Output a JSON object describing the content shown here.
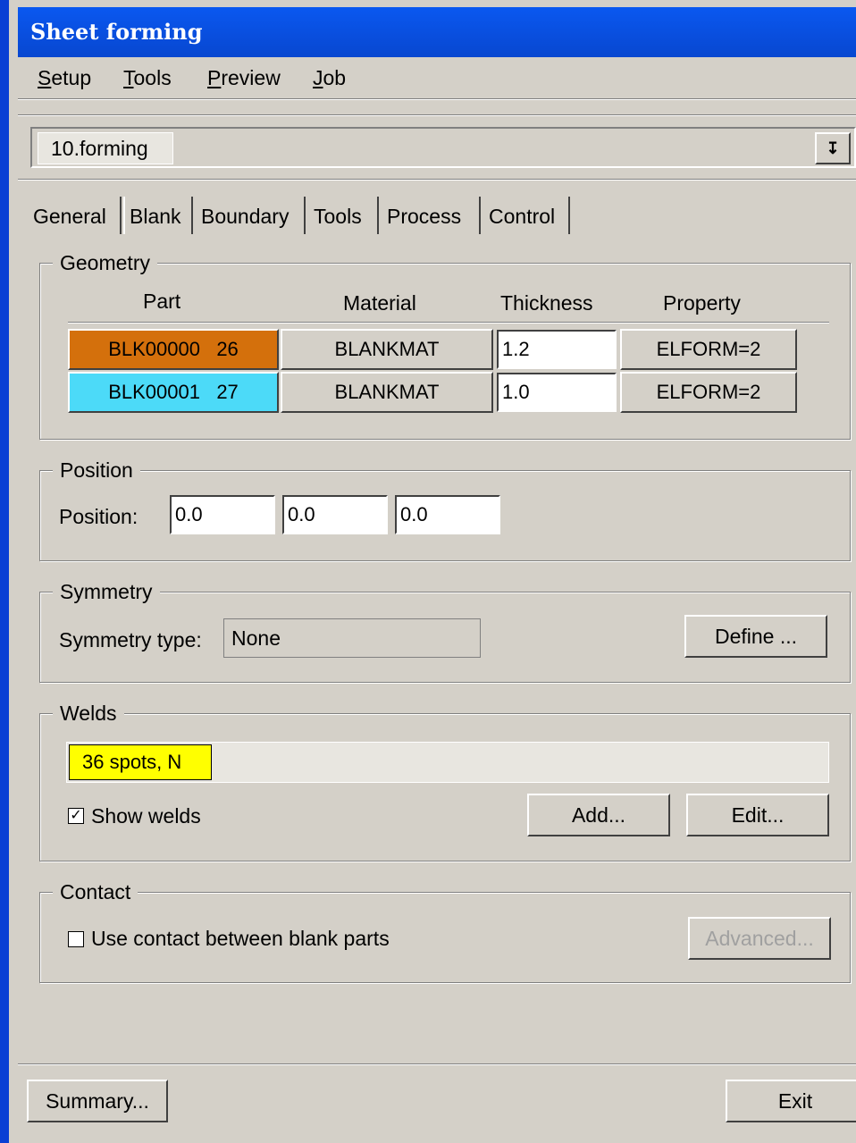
{
  "window": {
    "title": "Sheet forming"
  },
  "menu": [
    {
      "key": "S",
      "rest": "etup"
    },
    {
      "key": "T",
      "rest": "ools"
    },
    {
      "key": "P",
      "rest": "review"
    },
    {
      "key": "J",
      "rest": "ob"
    }
  ],
  "stage_selector": {
    "value": "10.forming"
  },
  "tabs": [
    "General",
    "Blank",
    "Boundary",
    "Tools",
    "Process",
    "Control"
  ],
  "active_tab": "Blank",
  "geometry": {
    "title": "Geometry",
    "headers": {
      "part": "Part",
      "material": "Material",
      "thickness": "Thickness",
      "property": "Property"
    },
    "rows": [
      {
        "part_name": "BLK00000",
        "part_id": "26",
        "color": "#d4700c",
        "material": "BLANKMAT",
        "thickness": "1.2",
        "property": "ELFORM=2"
      },
      {
        "part_name": "BLK00001",
        "part_id": "27",
        "color": "#4cdaf8",
        "material": "BLANKMAT",
        "thickness": "1.0",
        "property": "ELFORM=2"
      }
    ]
  },
  "position": {
    "title": "Position",
    "label": "Position:",
    "x": "0.0",
    "y": "0.0",
    "z": "0.0"
  },
  "symmetry": {
    "title": "Symmetry",
    "type_label": "Symmetry type:",
    "type_value": "None",
    "define_label": "Define ..."
  },
  "welds": {
    "title": "Welds",
    "summary": "36 spots, N",
    "chip_color": "#ffff00",
    "show_welds_label": "Show welds",
    "show_welds_checked": true,
    "add_label": "Add...",
    "edit_label": "Edit..."
  },
  "contact": {
    "title": "Contact",
    "use_contact_label": "Use contact between blank parts",
    "use_contact_checked": false,
    "advanced_label": "Advanced..."
  },
  "footer": {
    "summary_label": "Summary...",
    "exit_label": "Exit"
  }
}
